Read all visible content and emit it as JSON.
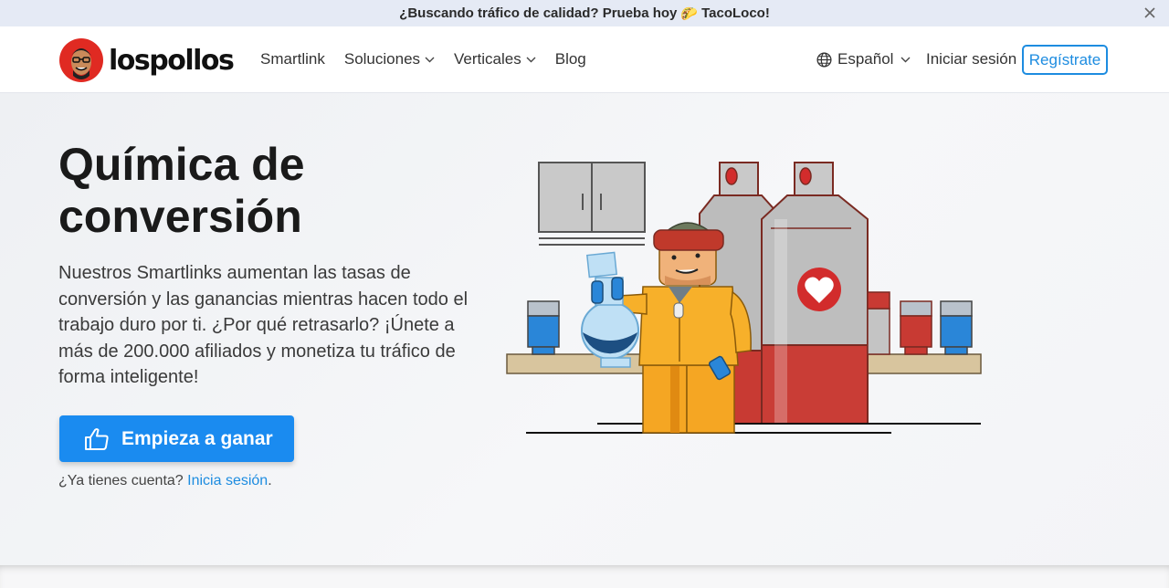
{
  "promo": {
    "text_before": "¿Buscando tráfico de calidad? Prueba hoy",
    "text_after": "TacoLoco!",
    "taco_icon": "🌮"
  },
  "header": {
    "logo_text": "lospollos",
    "nav": [
      {
        "label": "Smartlink",
        "has_dropdown": false
      },
      {
        "label": "Soluciones",
        "has_dropdown": true
      },
      {
        "label": "Verticales",
        "has_dropdown": true
      },
      {
        "label": "Blog",
        "has_dropdown": false
      }
    ],
    "language": "Español",
    "login": "Iniciar sesión",
    "signup": "Regístrate"
  },
  "hero": {
    "title_line1": "Química de",
    "title_line2": "conversión",
    "description": "Nuestros Smartlinks aumentan las tasas de conversión y las ganancias mientras hacen todo el trabajo duro por ti. ¿Por qué retrasarlo? ¡Únete a más de 200.000 afiliados y monetiza tu tráfico de forma inteligente!",
    "cta_label": "Empieza a ganar",
    "account_question": "¿Ya tienes cuenta?",
    "account_link": "Inicia sesión",
    "account_suffix": "."
  },
  "colors": {
    "accent": "#1a8bf0",
    "link": "#1d8ce0",
    "promo_bg": "#e5eaf5",
    "logo_red": "#e02a22"
  },
  "icons": [
    "close-icon",
    "chevron-down-icon",
    "globe-icon",
    "thumbs-up-icon",
    "logo-mark-icon"
  ]
}
